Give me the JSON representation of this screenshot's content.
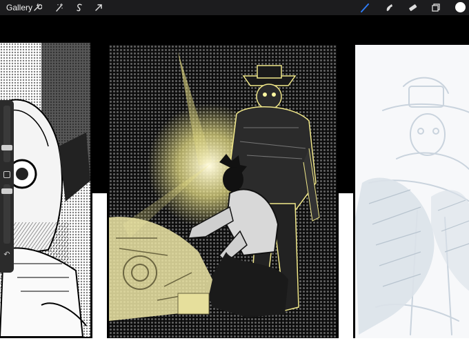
{
  "app": {
    "gallery_label": "Gallery"
  },
  "toolbar_left": [
    {
      "name": "wrench-icon"
    },
    {
      "name": "magic-wand-icon"
    },
    {
      "name": "selection-s-icon"
    },
    {
      "name": "transform-arrow-icon"
    }
  ],
  "toolbar_right": [
    {
      "name": "brush-icon",
      "active": true
    },
    {
      "name": "smudge-icon"
    },
    {
      "name": "eraser-icon"
    },
    {
      "name": "layers-icon"
    }
  ],
  "colors": {
    "topbar": "#1c1c1e",
    "active_tool": "#2f7cf6",
    "current_color": "#ffffff",
    "glow": "#f2e98a",
    "sketch": "#c9d3dd"
  },
  "sidebar": {
    "brush_size_level": 0.35,
    "opacity_level": 0.55
  }
}
